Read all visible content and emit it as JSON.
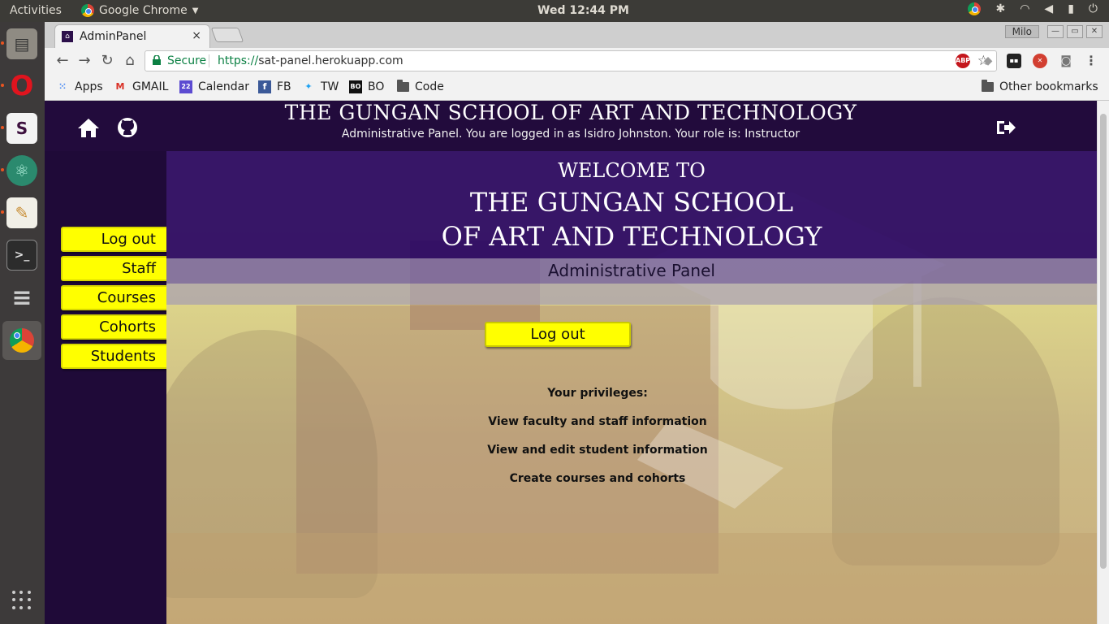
{
  "system": {
    "activities": "Activities",
    "app_menu": "Google Chrome",
    "clock": "Wed 12:44 PM"
  },
  "browser": {
    "tab_title": "AdminPanel",
    "tab_close": "×",
    "profile": "Milo",
    "secure_label": "Secure",
    "url_scheme": "https://",
    "url_rest": "sat-panel.herokuapp.com",
    "bookmarks": [
      {
        "label": "Apps"
      },
      {
        "label": "GMAIL"
      },
      {
        "label": "Calendar"
      },
      {
        "label": "FB"
      },
      {
        "label": "TW"
      },
      {
        "label": "BO"
      },
      {
        "label": "Code"
      }
    ],
    "other_bookmarks": "Other bookmarks",
    "calendar_day": "22",
    "abp": "ABP"
  },
  "site": {
    "title": "THE GUNGAN SCHOOL OF ART AND TECHNOLOGY",
    "logged_line": "Administrative Panel. You are logged in as Isidro Johnston. Your role is: Instructor",
    "welcome_small": "WELCOME TO",
    "welcome_line1": "THE GUNGAN SCHOOL",
    "welcome_line2": "OF ART AND TECHNOLOGY",
    "panel_label": "Administrative Panel",
    "nav": [
      "Log out",
      "Staff",
      "Courses",
      "Cohorts",
      "Students"
    ],
    "main_logout": "Log out",
    "privileges_heading": "Your privileges:",
    "privileges": [
      "View faculty and staff information",
      "View and edit student information",
      "Create courses and cohorts"
    ]
  },
  "colors": {
    "accent_button": "#ffff00",
    "header_bg": "#220b3c",
    "band_bg": "#2c0666"
  }
}
